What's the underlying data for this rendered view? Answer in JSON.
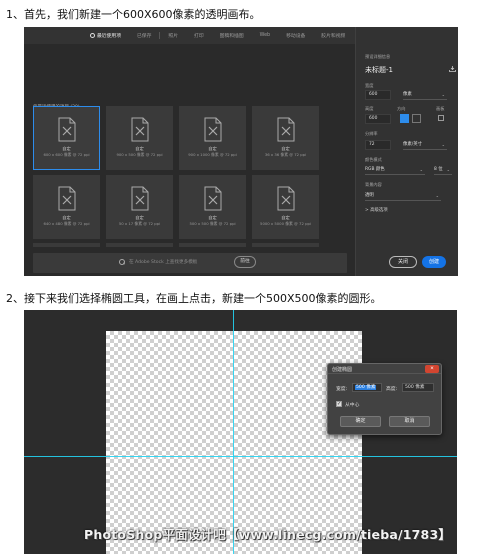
{
  "step1": {
    "text": "1、首先，我们新建一个600X600像素的透明画布。"
  },
  "step2": {
    "text": "2、接下来我们选择椭圆工具，在画上点击，新建一个500X500像素的圆形。"
  },
  "new_document_dialog": {
    "tabs": [
      "最近使用项",
      "已保存",
      "照片",
      "打印",
      "图稿和插图",
      "Web",
      "移动设备",
      "胶片和视频"
    ],
    "active_tab": "最近使用项",
    "recent_label": "您最近使用的项目 (20)",
    "presets": [
      {
        "name": "自定",
        "size": "600 x 600 像素 @ 72 ppi"
      },
      {
        "name": "自定",
        "size": "900 x 500 像素 @ 72 ppi"
      },
      {
        "name": "自定",
        "size": "900 x 1000 像素 @ 72 ppi"
      },
      {
        "name": "自定",
        "size": "36 x 36 像素 @ 72 ppi"
      },
      {
        "name": "自定",
        "size": "640 x 480 像素 @ 72 ppi"
      },
      {
        "name": "自定",
        "size": "50 x 17 像素 @ 72 ppi"
      },
      {
        "name": "自定",
        "size": "500 x 500 像素 @ 72 ppi"
      },
      {
        "name": "自定",
        "size": "5000 x 5000 像素 @ 72 ppi"
      }
    ],
    "search_placeholder": "在 Adobe Stock 上查找更多模板",
    "go_button": "前往",
    "panel": {
      "section_title": "预设详细信息",
      "doc_title": "未标题-1",
      "width_label": "宽度",
      "width_value": "600",
      "width_unit": "像素",
      "height_label": "高度",
      "height_value": "600",
      "orientation_label": "方向",
      "artboard_label": "画板",
      "resolution_label": "分辨率",
      "resolution_value": "72",
      "resolution_unit": "像素/英寸",
      "color_mode_label": "颜色模式",
      "color_mode_value": "RGB 颜色",
      "bit_depth": "8 位",
      "background_label": "背景内容",
      "background_value": "透明",
      "advanced": "> 高级选项"
    },
    "close_button": "关闭",
    "create_button": "创建"
  },
  "create_ellipse_dialog": {
    "title": "创建椭圆",
    "width_label": "宽度:",
    "width_value": "500 像素",
    "height_label": "高度:",
    "height_value": "500 像素",
    "from_center_label": "从中心",
    "ok_button": "确定",
    "cancel_button": "取消"
  },
  "watermark": "PhotoShop平面设计吧【www.linecg.com/tieba/1783】"
}
